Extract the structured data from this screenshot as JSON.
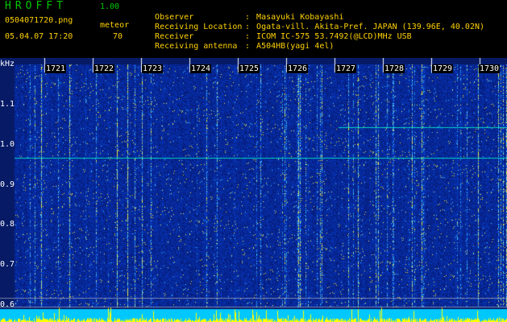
{
  "app": {
    "title": "HROFFT",
    "version": "1.00"
  },
  "file": {
    "name": "0504071720.png",
    "mode": "meteor",
    "timestamp": "05.04.07 17:20",
    "count": "70"
  },
  "info": [
    {
      "key": "Observer",
      "sep": ":",
      "value": "Masayuki Kobayashi"
    },
    {
      "key": "Receiving Location",
      "sep": ":",
      "value": "Ogata-vill. Akita-Pref. JAPAN (139.96E, 40.02N)"
    },
    {
      "key": "Receiver",
      "sep": ":",
      "value": "ICOM IC-575 53.7492(@LCD)MHz USB"
    },
    {
      "key": "Receiving antenna",
      "sep": ":",
      "value": "A504HB(yagi 4el)"
    }
  ],
  "axis": {
    "unit": "kHz",
    "yticks": [
      "1.1",
      "1.0",
      "0.9",
      "0.8",
      "0.7",
      "0.6"
    ],
    "minutes": [
      "1721",
      "1722",
      "1723",
      "1724",
      "1725",
      "1726",
      "1727",
      "1728",
      "1729",
      "1730"
    ]
  },
  "colors": {
    "bg": "#061a66",
    "signal": "#00ffd0",
    "meteor": "#ffff00",
    "label": "#ffd200",
    "title": "#00c800"
  }
}
